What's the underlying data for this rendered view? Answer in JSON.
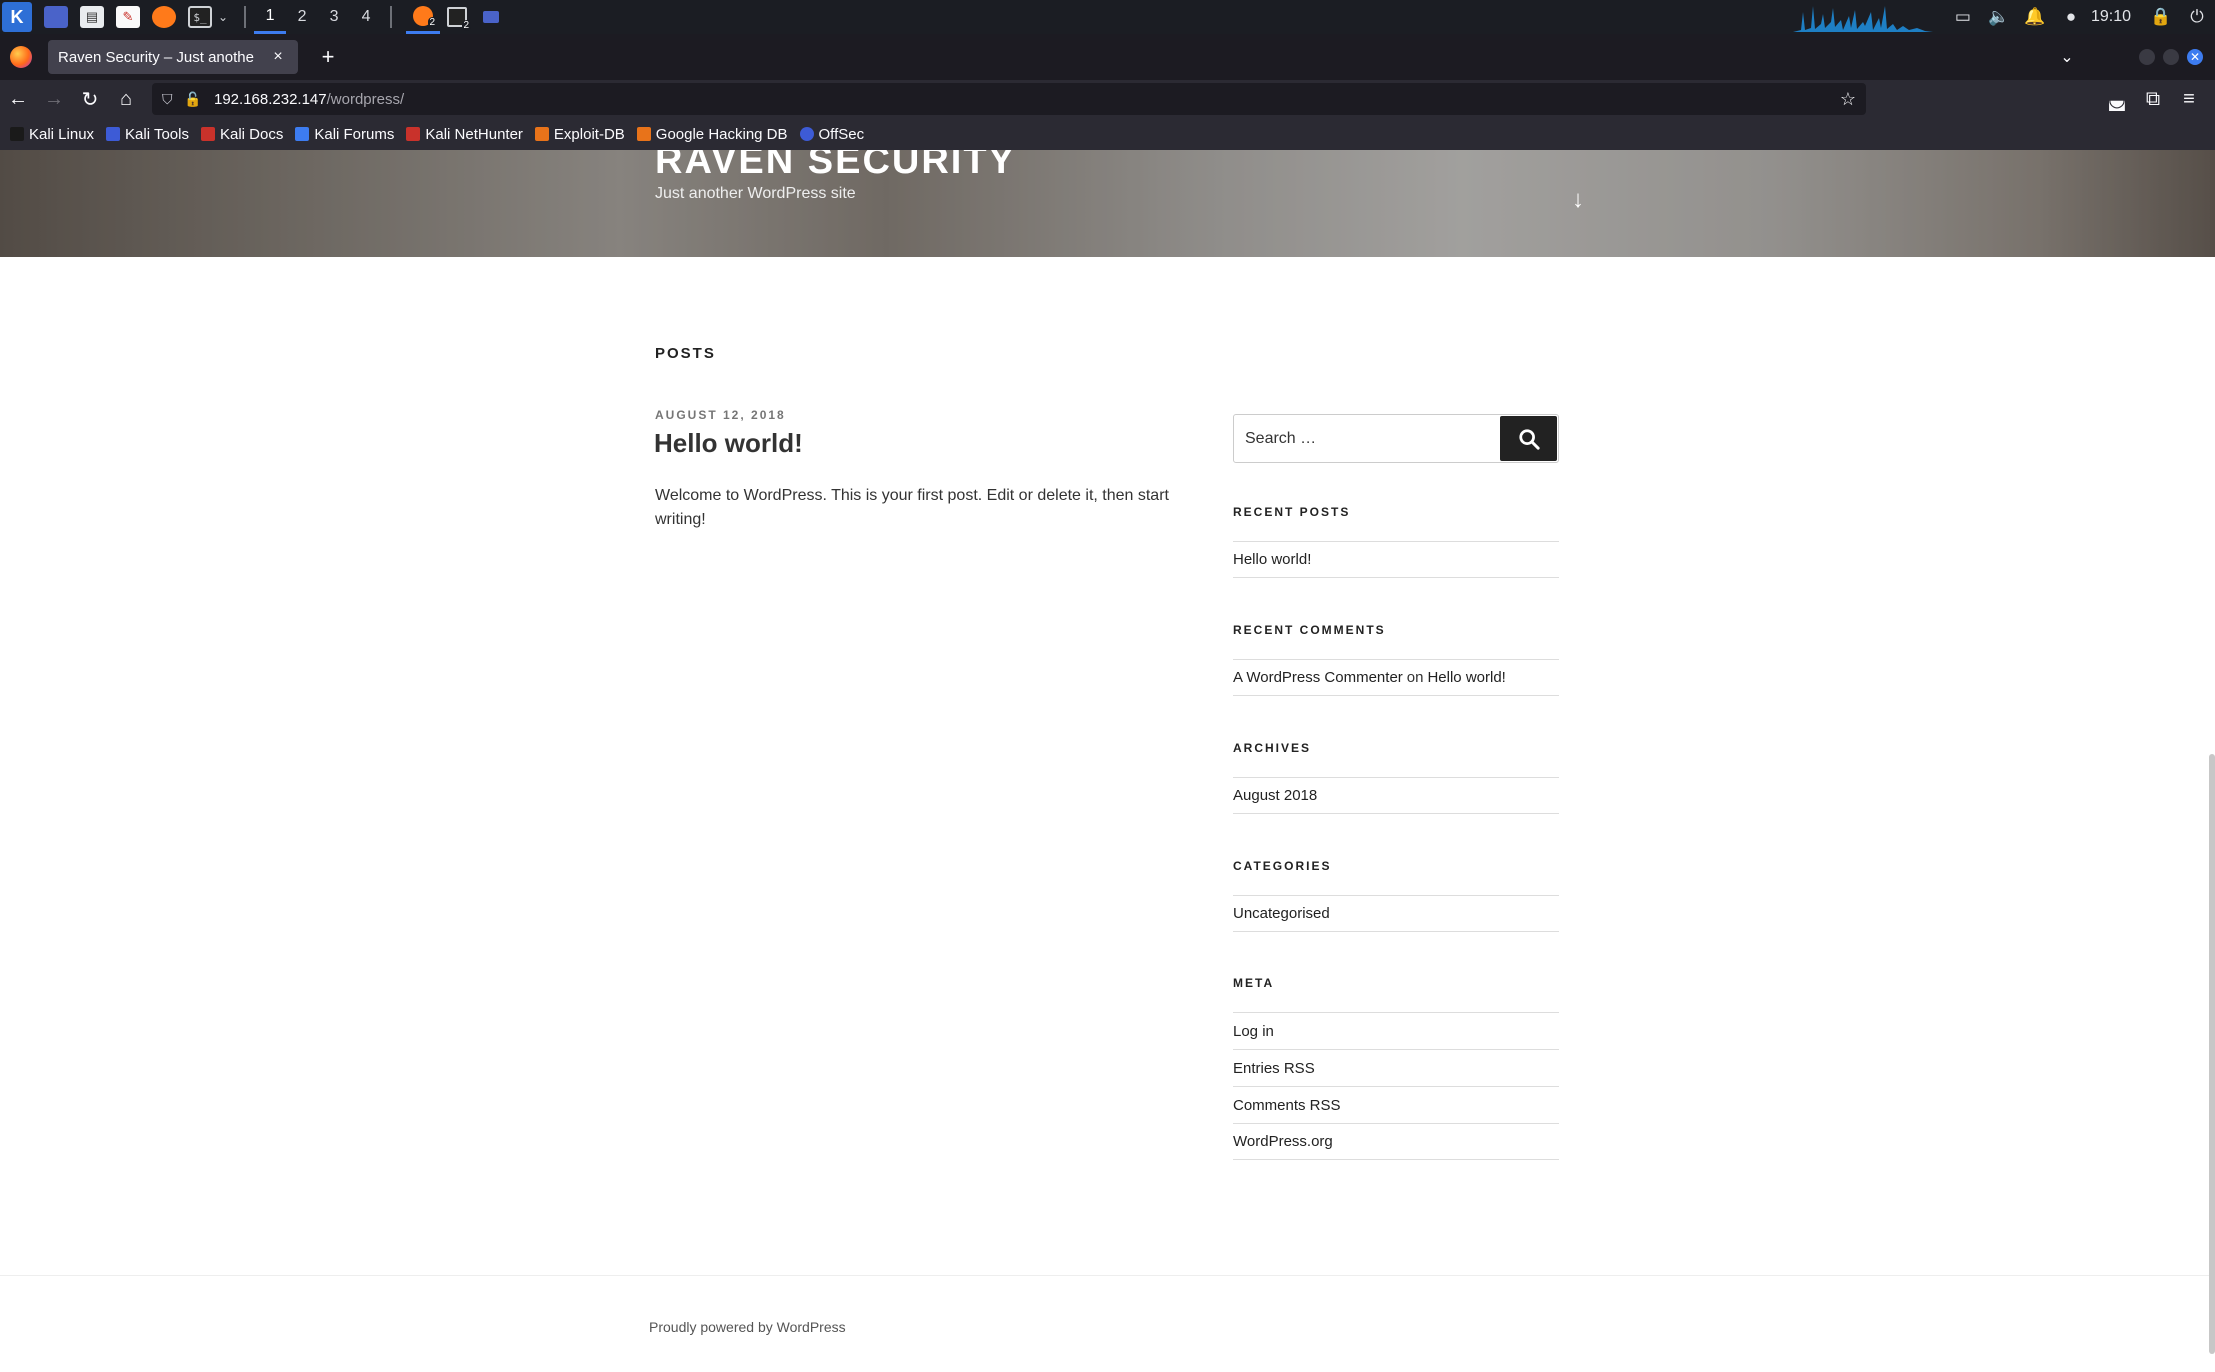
{
  "panel": {
    "workspaces": [
      "1",
      "2",
      "3",
      "4"
    ],
    "task_counts": [
      "2",
      "2"
    ],
    "clock": "19:10"
  },
  "browser": {
    "tab_title": "Raven Security – Just anothe",
    "tab_close": "×",
    "new_tab": "+",
    "url_host": "192.168.232.147",
    "url_path": "/wordpress/"
  },
  "bookmarks": [
    {
      "label": "Kali Linux",
      "color": "#1a1a1a"
    },
    {
      "label": "Kali Tools",
      "color": "#3d5bd6"
    },
    {
      "label": "Kali Docs",
      "color": "#c9322b"
    },
    {
      "label": "Kali Forums",
      "color": "#3d7cf0"
    },
    {
      "label": "Kali NetHunter",
      "color": "#c9322b"
    },
    {
      "label": "Exploit-DB",
      "color": "#e8731a"
    },
    {
      "label": "Google Hacking DB",
      "color": "#e8731a"
    },
    {
      "label": "OffSec",
      "color": "#3d5bd6"
    }
  ],
  "site": {
    "title": "RAVEN SECURITY",
    "description": "Just another WordPress site"
  },
  "main": {
    "heading": "POSTS",
    "post": {
      "date": "AUGUST 12, 2018",
      "title": "Hello world!",
      "excerpt": "Welcome to WordPress. This is your first post. Edit or delete it, then start writing!"
    }
  },
  "sidebar": {
    "search_placeholder": "Search …",
    "recent_posts": {
      "title": "RECENT POSTS",
      "items": [
        "Hello world!"
      ]
    },
    "recent_comments": {
      "title": "RECENT COMMENTS",
      "author": "A WordPress Commenter",
      "on": "on",
      "post": "Hello world!"
    },
    "archives": {
      "title": "ARCHIVES",
      "items": [
        "August 2018"
      ]
    },
    "categories": {
      "title": "CATEGORIES",
      "items": [
        "Uncategorised"
      ]
    },
    "meta": {
      "title": "META",
      "items": [
        "Log in",
        "Entries RSS",
        "Comments RSS",
        "WordPress.org"
      ]
    }
  },
  "footer": {
    "credit": "Proudly powered by WordPress"
  },
  "colors": {
    "panel_bg": "#1b1d23",
    "accent": "#3d7cf0",
    "search_button": "#222222"
  }
}
